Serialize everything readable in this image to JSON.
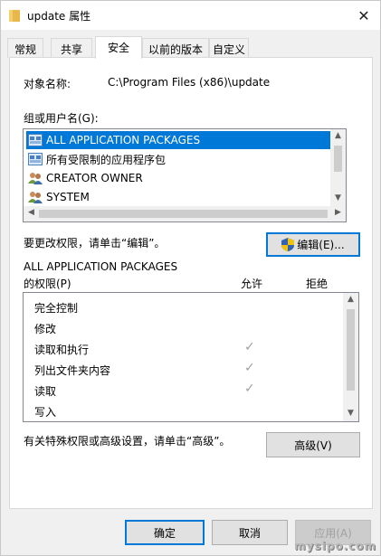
{
  "window": {
    "title": "update 属性",
    "close_glyph": "✕"
  },
  "tabs": [
    {
      "label": "常规"
    },
    {
      "label": "共享"
    },
    {
      "label": "安全",
      "active": true
    },
    {
      "label": "以前的版本"
    },
    {
      "label": "自定义"
    }
  ],
  "security": {
    "object_name_label": "对象名称:",
    "object_name_value": "C:\\Program Files (x86)\\update",
    "group_label": "组或用户名(G):",
    "users": [
      {
        "name": "ALL APPLICATION PACKAGES",
        "icon": "app-packages-icon",
        "selected": true
      },
      {
        "name": "所有受限制的应用程序包",
        "icon": "app-packages-icon"
      },
      {
        "name": "CREATOR OWNER",
        "icon": "users-group-icon"
      },
      {
        "name": "SYSTEM",
        "icon": "users-group-icon"
      }
    ],
    "change_text": "要更改权限，请单击“编辑”。",
    "edit_button": "编辑(E)...",
    "permissions_for_line1": "ALL APPLICATION PACKAGES",
    "permissions_for_line2": "的权限(P)",
    "allow_header": "允许",
    "deny_header": "拒绝",
    "permissions": [
      {
        "name": "完全控制",
        "allow": false
      },
      {
        "name": "修改",
        "allow": false
      },
      {
        "name": "读取和执行",
        "allow": true
      },
      {
        "name": "列出文件夹内容",
        "allow": true
      },
      {
        "name": "读取",
        "allow": true
      },
      {
        "name": "写入",
        "allow": false
      }
    ],
    "check_glyph": "✓",
    "special_text": "有关特殊权限或高级设置，请单击“高级”。",
    "advanced_button": "高级(V)"
  },
  "footer": {
    "ok_button": "确定",
    "cancel_button": "取消",
    "apply_button": "应用(A)"
  },
  "watermark": "mysipo.com",
  "colors": {
    "selection": "#0078d7",
    "checkmark_disabled": "#a0a0a0"
  }
}
